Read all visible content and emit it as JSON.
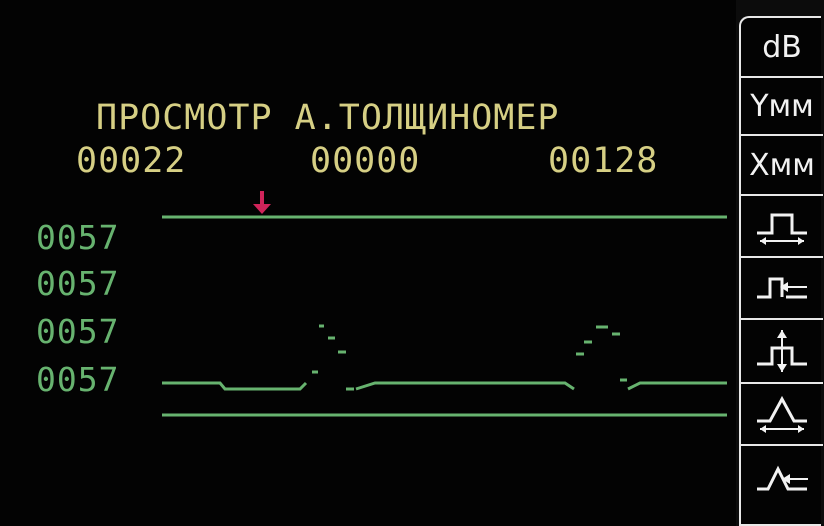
{
  "screen": {
    "title": "ПРОСМОТР А.ТОЛЩИНОМЕР",
    "counters": [
      "00022",
      "00000",
      "00128"
    ],
    "level_labels": [
      "0057",
      "0057",
      "0057",
      "0057"
    ]
  },
  "softkeys": [
    {
      "label": "dB",
      "kind": "text"
    },
    {
      "label": "Yмм",
      "kind": "text"
    },
    {
      "label": "Xмм",
      "kind": "text"
    },
    {
      "icon": "gate-width-icon",
      "kind": "icon"
    },
    {
      "icon": "gate-start-icon",
      "kind": "icon"
    },
    {
      "icon": "gate-level-icon",
      "kind": "icon"
    },
    {
      "icon": "peak-width-icon",
      "kind": "icon"
    },
    {
      "icon": "signal-amplitude-icon",
      "kind": "icon"
    }
  ],
  "colors": {
    "title_text": "#d6cf84",
    "trace": "#67b36f",
    "marker": "#d0245a",
    "softkey_border": "#e8e8e8",
    "background": "#030303"
  }
}
